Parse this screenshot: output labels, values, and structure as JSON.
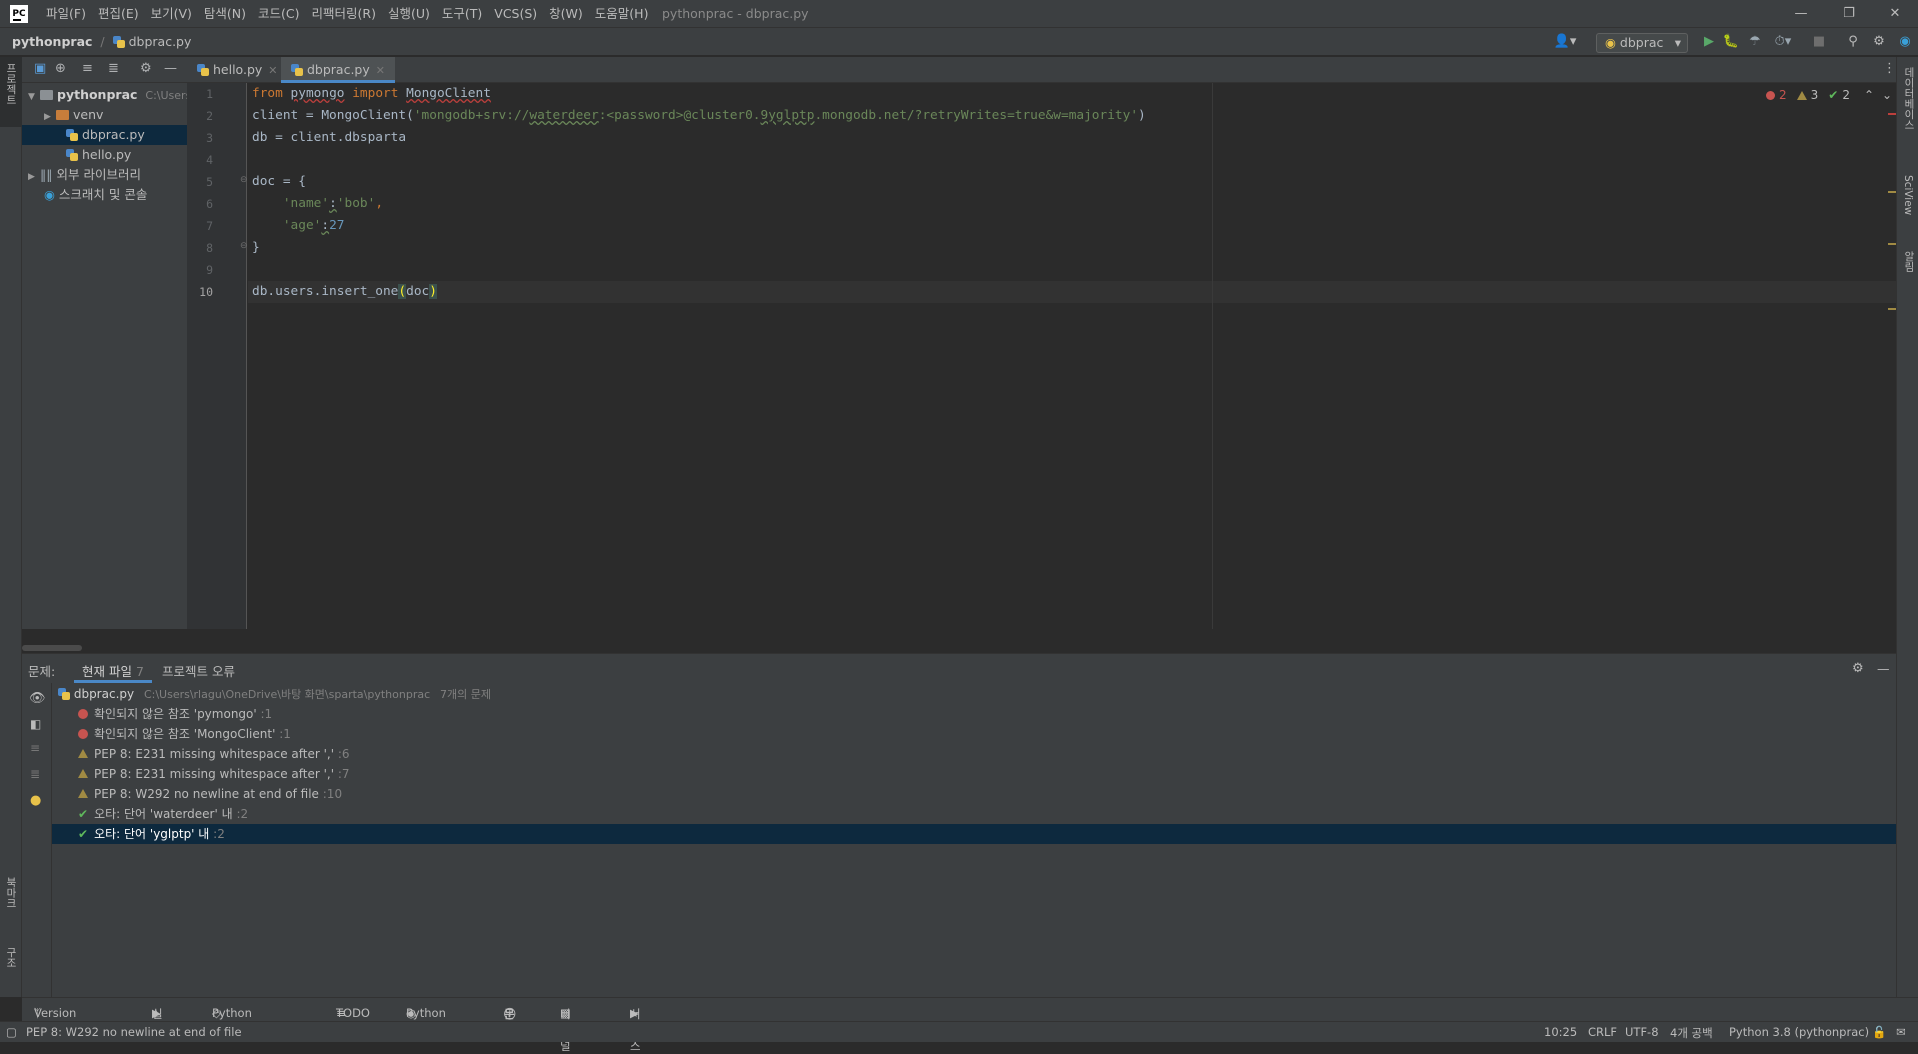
{
  "app": {
    "logo": "PC",
    "menu": [
      "파일(F)",
      "편집(E)",
      "보기(V)",
      "탐색(N)",
      "코드(C)",
      "리팩터링(R)",
      "실행(U)",
      "도구(T)",
      "VCS(S)",
      "창(W)",
      "도움말(H)"
    ],
    "window_title": "pythonprac - dbprac.py"
  },
  "breadcrumb": {
    "project": "pythonprac",
    "file": "dbprac.py"
  },
  "run_config": {
    "name": "dbprac"
  },
  "left_strip": {
    "project_label": "프로젝트",
    "bookmarks_label": "북마크",
    "structure_label": "구조"
  },
  "right_strip": {
    "database_label": "데이터베이스",
    "sciview_label": "SciView",
    "notifications_label": "알림"
  },
  "project_tree": {
    "root": {
      "name": "pythonprac",
      "path": "C:\\Users\\"
    },
    "items": [
      {
        "name": "venv"
      },
      {
        "name": "dbprac.py"
      },
      {
        "name": "hello.py"
      },
      {
        "name": "외부 라이브러리"
      },
      {
        "name": "스크래치 및 콘솔"
      }
    ]
  },
  "editor": {
    "tabs": [
      {
        "label": "hello.py"
      },
      {
        "label": "dbprac.py"
      }
    ],
    "line_numbers": [
      "1",
      "2",
      "3",
      "4",
      "5",
      "6",
      "7",
      "8",
      "9",
      "10"
    ],
    "code": {
      "l1_from": "from",
      "l1_module": "pymongo",
      "l1_import": "import",
      "l1_name": "MongoClient",
      "l2_pre": "client = MongoClient(",
      "l2_str1": "'mongodb+srv://",
      "l2_user": "waterdeer",
      "l2_str2": ":<password>@cluster0.",
      "l2_host": "9yglptp",
      "l2_str3": ".mongodb.net/?retryWrites=true&w=majority'",
      "l2_post": ")",
      "l3": "db = client.dbsparta",
      "l5": "doc = {",
      "l6_key": "'name'",
      "l6_colon": ":",
      "l6_val": "'bob'",
      "l6_comma": ",",
      "l7_key": "'age'",
      "l7_colon": ":",
      "l7_val": "27",
      "l8": "}",
      "l10_pre": "db.users.insert_one",
      "l10_open": "(",
      "l10_arg": "doc",
      "l10_close": ")"
    },
    "inspections": {
      "errors": "2",
      "warnings": "3",
      "typos": "2"
    }
  },
  "problems": {
    "title": "문제:",
    "tab_current": "현재 파일",
    "tab_current_count": "7",
    "tab_project": "프로젝트 오류",
    "file": {
      "name": "dbprac.py",
      "path": "C:\\Users\\rlagu\\OneDrive\\바탕 화면\\sparta\\pythonprac",
      "count": "7개의 문제"
    },
    "items": [
      {
        "type": "error",
        "text": "확인되지 않은 참조 'pymongo'",
        "loc": ":1"
      },
      {
        "type": "error",
        "text": "확인되지 않은 참조 'MongoClient'",
        "loc": ":1"
      },
      {
        "type": "warning",
        "text": "PEP 8: E231 missing whitespace after ','",
        "loc": ":6"
      },
      {
        "type": "warning",
        "text": "PEP 8: E231 missing whitespace after ','",
        "loc": ":7"
      },
      {
        "type": "warning",
        "text": "PEP 8: W292 no newline at end of file",
        "loc": ":10"
      },
      {
        "type": "typo",
        "text": "오타: 단어 'waterdeer' 내",
        "loc": ":2"
      },
      {
        "type": "typo",
        "text": "오타: 단어 'yglptp' 내",
        "loc": ":2"
      }
    ]
  },
  "bottom_tools": [
    "Version Control",
    "실행",
    "Python Packages",
    "TODO",
    "Python 콘솔",
    "문제",
    "터미널",
    "서비스"
  ],
  "status": {
    "message": "PEP 8: W292 no newline at end of file",
    "position": "10:25",
    "line_sep": "CRLF",
    "encoding": "UTF-8",
    "indent": "4개 공백",
    "interpreter": "Python 3.8 (pythonprac)"
  }
}
